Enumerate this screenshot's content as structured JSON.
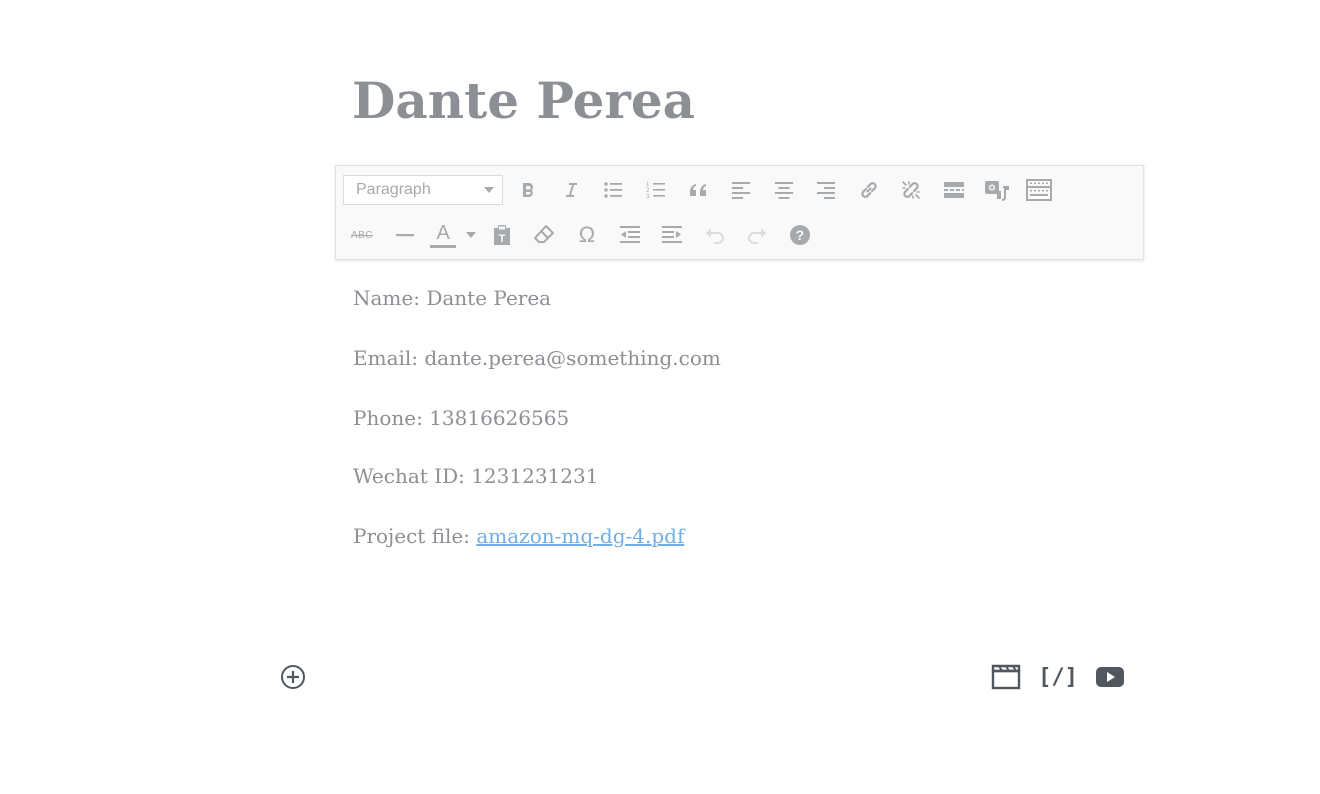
{
  "post": {
    "title": "Dante Perea"
  },
  "toolbar": {
    "format_select": {
      "selected": "Paragraph"
    },
    "row1": [
      "bold-icon",
      "italic-icon",
      "bullet-list-icon",
      "numbered-list-icon",
      "blockquote-icon",
      "align-left-icon",
      "align-center-icon",
      "align-right-icon",
      "link-icon",
      "unlink-icon",
      "read-more-icon",
      "image-text-icon",
      "toolbar-toggle-icon"
    ],
    "row2": [
      "strikethrough-icon",
      "horizontal-line-icon",
      "text-color-icon",
      "paste-text-icon",
      "clear-formatting-icon",
      "special-character-icon",
      "outdent-icon",
      "indent-icon",
      "undo-icon",
      "redo-icon",
      "help-icon"
    ],
    "strikethrough_glyph": "ABC",
    "text_color_glyph": "A",
    "special_char_glyph": "Ω",
    "help_glyph": "?"
  },
  "content": {
    "name_line": "Name: Dante Perea",
    "email_line": "Email: dante.perea@something.com",
    "phone_line": "Phone: 13816626565",
    "wechat_line": "Wechat ID: 1231231231",
    "project_label": "Project file: ",
    "project_link": "amazon-mq-dg-4.pdf"
  },
  "bottom_bar": {
    "shortcode_glyph": "[/]",
    "icons": [
      "add-block-icon",
      "video-icon",
      "shortcode-icon",
      "youtube-icon"
    ]
  },
  "colors": {
    "title": "#8c8f94",
    "body_text": "#8c8f94",
    "link": "#72aee6",
    "toolbar_icon": "#a7aaad",
    "bottom_icon": "#50575e"
  }
}
